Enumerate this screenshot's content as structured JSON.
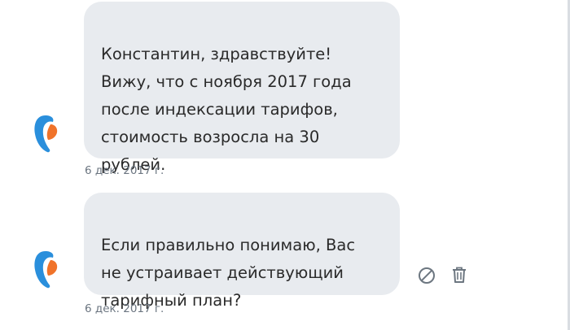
{
  "conversation": {
    "messages": [
      {
        "sender_icon": "rostelecom-logo-icon",
        "text": "Константин, здравствуйте!\nВижу, что с ноября 2017 года\nпосле индексации тарифов,\nстоимость возросла на 30\nрублей.",
        "timestamp": "6 дек. 2017 г."
      },
      {
        "sender_icon": "rostelecom-logo-icon",
        "text": "Если правильно понимаю, Вас\nне устраивает действующий\nтарифный план?",
        "timestamp": "6 дек. 2017 г.",
        "actions": [
          "block-icon",
          "trash-icon"
        ]
      }
    ]
  },
  "colors": {
    "bubble": "#e8ebef",
    "text": "#2a2a2a",
    "timestamp": "#6b7580",
    "logo_blue": "#2a8fdc",
    "logo_orange": "#f0732a",
    "action_icon": "#6c7680"
  }
}
